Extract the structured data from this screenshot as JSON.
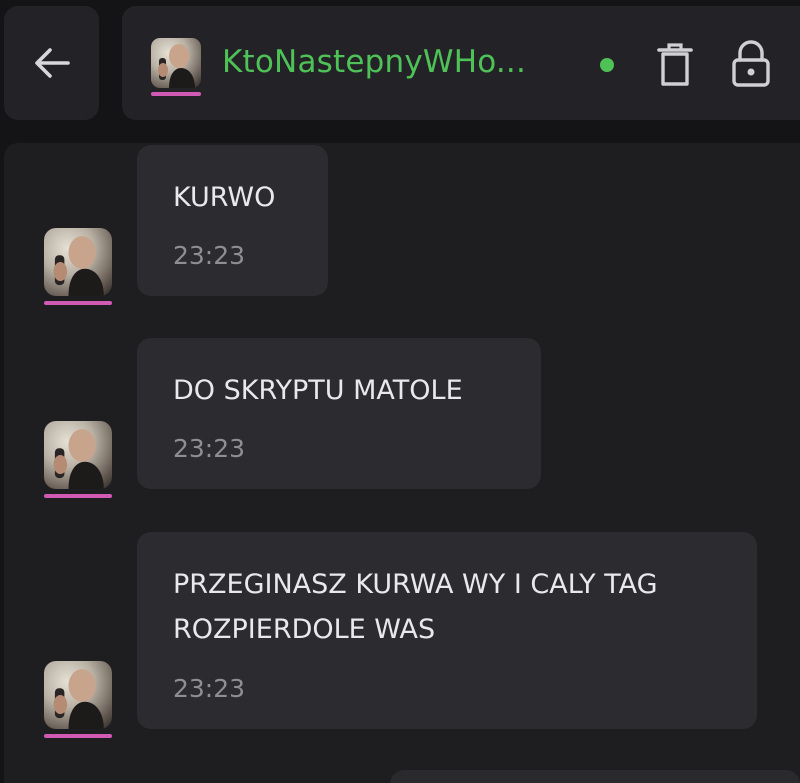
{
  "header": {
    "contact_name": "KtoNastepnyWHo...",
    "status": "online",
    "icons": {
      "back": "back-arrow-icon",
      "delete": "trash-icon",
      "lock": "lock-icon"
    },
    "colors": {
      "accent_green": "#4ec157",
      "avatar_underline": "#d15ab5"
    }
  },
  "messages": [
    {
      "text": "KURWO",
      "time": "23:23"
    },
    {
      "text": "DO SKRYPTU MATOLE",
      "time": "23:23"
    },
    {
      "text": "PRZEGINASZ KURWA WY I CALY TAG\nROZPIERDOLE WAS",
      "time": "23:23"
    }
  ]
}
